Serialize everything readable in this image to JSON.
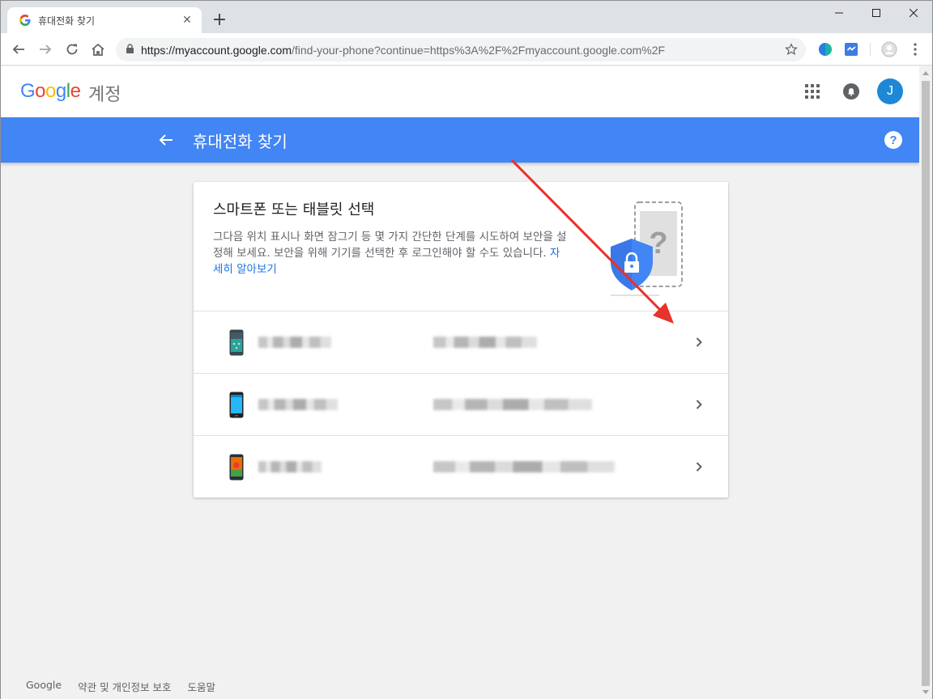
{
  "browser": {
    "tab_title": "휴대전화 찾기",
    "tab_close": "✕",
    "new_tab": "+",
    "url_host": "https://myaccount.google.com",
    "url_rest": "/find-your-phone?continue=https%3A%2F%2Fmyaccount.google.com%2F",
    "profile_icon": "avatar-icon",
    "extensions": [
      "color-circle-extension-icon",
      "blue-check-extension-icon"
    ]
  },
  "header": {
    "logo": "Google",
    "product": "계정",
    "avatar_letter": "J"
  },
  "bar": {
    "title": "휴대전화 찾기",
    "help": "?"
  },
  "card": {
    "title": "스마트폰 또는 태블릿 선택",
    "description": "그다음 위치 표시나 화면 잠그기 등 몇 가지 간단한 단계를 시도하여 보안을 설정해 보세요. 보안을 위해 기기를 선택한 후 로그인해야 할 수도 있습니다.",
    "learn_more": "자세히 알아보기"
  },
  "devices": [
    {
      "name": "",
      "detail": "",
      "icon": "phone-icon"
    },
    {
      "name": "",
      "detail": "",
      "icon": "phone-icon"
    },
    {
      "name": "",
      "detail": "",
      "icon": "phone-icon"
    }
  ],
  "footer": {
    "google": "Google",
    "terms": "약관 및 개인정보 보호",
    "help": "도움말"
  },
  "colors": {
    "accent": "#4285f4",
    "annotation_arrow": "#e8322b",
    "avatar": "#1e88d6"
  }
}
